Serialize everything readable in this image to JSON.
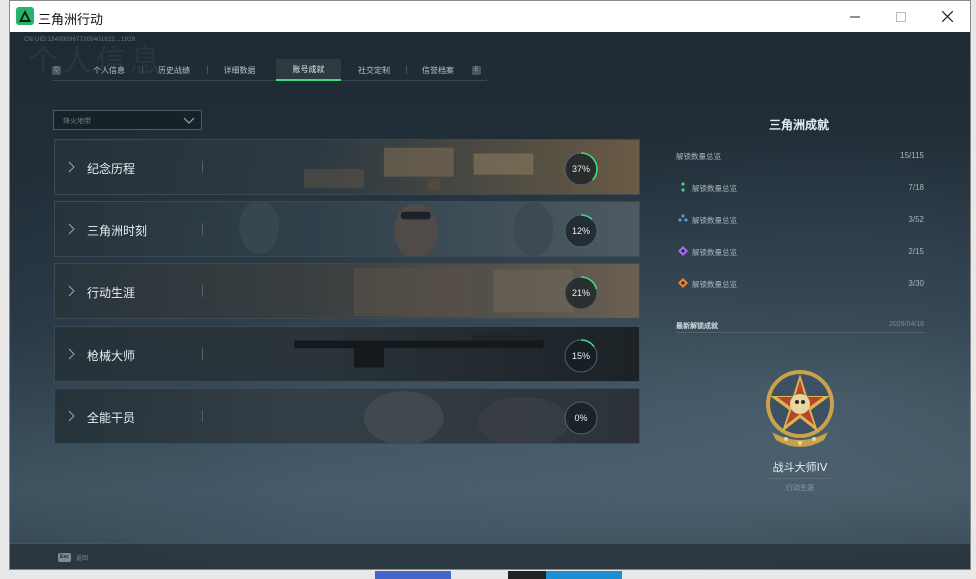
{
  "window": {
    "title": "三角洲行动"
  },
  "header": {
    "uid": "CN UID:1849959677309401622…1928",
    "ghost_title": "个人信息"
  },
  "tabs": [
    {
      "label": "个人信息",
      "active": false
    },
    {
      "label": "历史战绩",
      "active": false
    },
    {
      "label": "详细数据",
      "active": false
    },
    {
      "label": "账号成就",
      "active": true
    },
    {
      "label": "社交定制",
      "active": false
    },
    {
      "label": "信誉档案",
      "active": false
    }
  ],
  "filter": {
    "label": "烽火地带"
  },
  "categories": [
    {
      "label": "纪念历程",
      "progress": 37,
      "progress_text": "37%"
    },
    {
      "label": "三角洲时刻",
      "progress": 12,
      "progress_text": "12%"
    },
    {
      "label": "行动生涯",
      "progress": 21,
      "progress_text": "21%"
    },
    {
      "label": "枪械大师",
      "progress": 15,
      "progress_text": "15%"
    },
    {
      "label": "全能干员",
      "progress": 0,
      "progress_text": "0%"
    }
  ],
  "panel": {
    "title": "三角洲成就",
    "total": {
      "label": "解锁数量总览",
      "value": "15/115"
    },
    "stats": [
      {
        "label": "解锁数量总览",
        "value": "7/18",
        "icon": "green-rank-icon",
        "color": "#3ddc84"
      },
      {
        "label": "解锁数量总览",
        "value": "3/52",
        "icon": "blue-rank-icon",
        "color": "#4aa3e8"
      },
      {
        "label": "解锁数量总览",
        "value": "2/15",
        "icon": "purple-rank-icon",
        "color": "#a56cf0"
      },
      {
        "label": "解锁数量总览",
        "value": "3/30",
        "icon": "orange-rank-icon",
        "color": "#e8893a"
      }
    ],
    "latest": {
      "label": "最新解锁成就",
      "date": "2026/04/18"
    },
    "medal": {
      "name": "战斗大师IV",
      "category": "行动生涯"
    }
  },
  "footer": {
    "esc_key": "Esc",
    "esc_label": "返回"
  }
}
